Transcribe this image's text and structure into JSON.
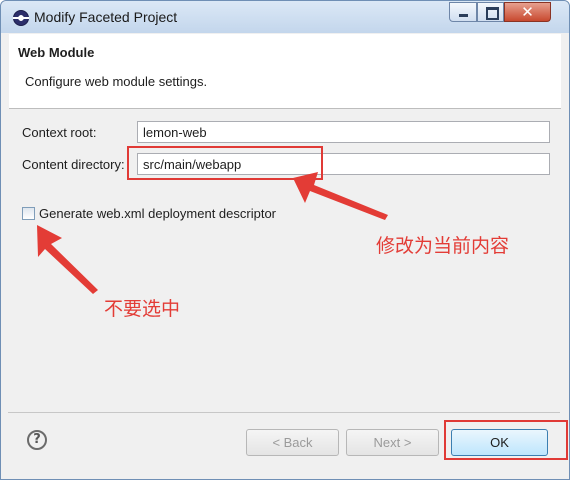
{
  "window": {
    "title": "Modify Faceted Project",
    "controls": {
      "minimize_icon": "minimize-icon",
      "maximize_icon": "maximize-icon",
      "close_glyph": "✕"
    }
  },
  "header": {
    "title": "Web Module",
    "description": "Configure web module settings."
  },
  "form": {
    "context_root_label": "Context root:",
    "context_root_value": "lemon-web",
    "content_dir_label": "Content directory:",
    "content_dir_value": "src/main/webapp",
    "generate_xml_label": "Generate web.xml deployment descriptor",
    "generate_xml_checked": false
  },
  "footer": {
    "help_glyph": "?",
    "back_label": "< Back",
    "next_label": "Next >",
    "ok_label": "OK"
  },
  "annotations": {
    "content_dir_note": "修改为当前内容",
    "checkbox_note": "不要选中",
    "color": "#e33c36"
  }
}
